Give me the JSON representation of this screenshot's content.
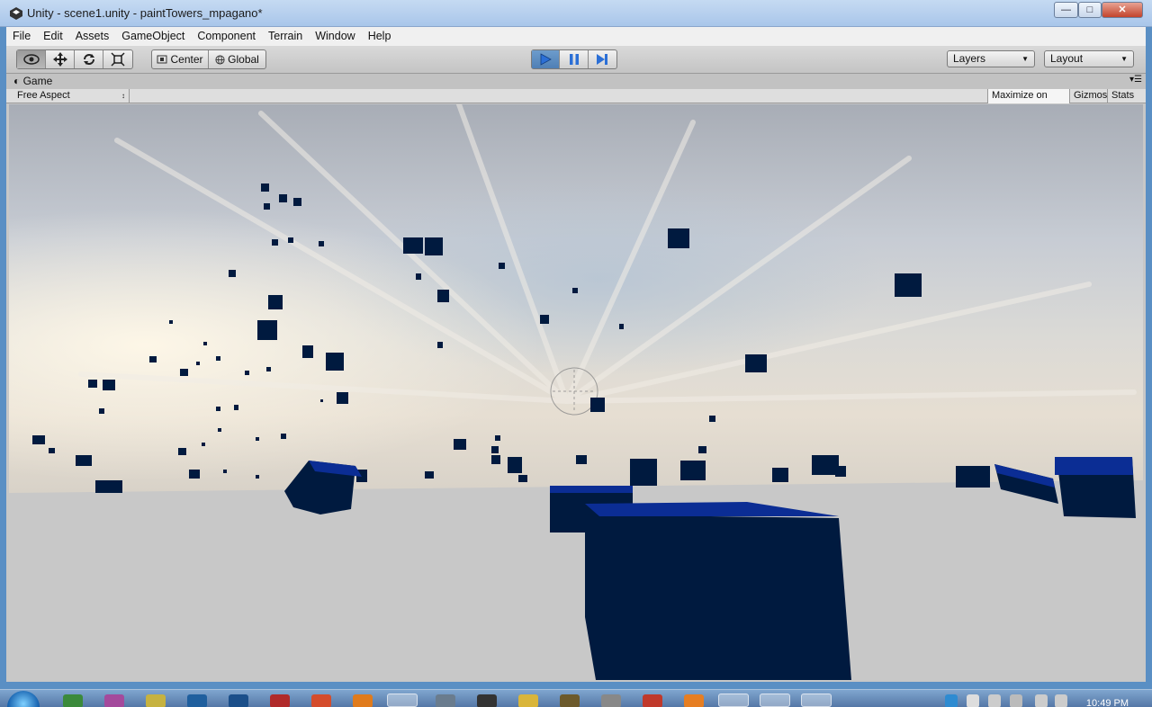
{
  "window": {
    "title": "Unity - scene1.unity - paintTowers_mpagano*"
  },
  "menu": [
    "File",
    "Edit",
    "Assets",
    "GameObject",
    "Component",
    "Terrain",
    "Window",
    "Help"
  ],
  "toolbar": {
    "pivot_label": "Center",
    "space_label": "Global",
    "layers_label": "Layers",
    "layout_label": "Layout"
  },
  "game": {
    "tab_label": "Game",
    "aspect_label": "Free Aspect",
    "maximize_label": "Maximize on Play",
    "gizmos_label": "Gizmos",
    "stats_label": "Stats"
  },
  "taskbar": {
    "clock": "10:49 PM"
  },
  "colors": {
    "cube_dark": "#001a3f",
    "cube_light": "#0b2d94",
    "floor": "#c8c8c8",
    "accent_play": "#4f7fb5"
  }
}
